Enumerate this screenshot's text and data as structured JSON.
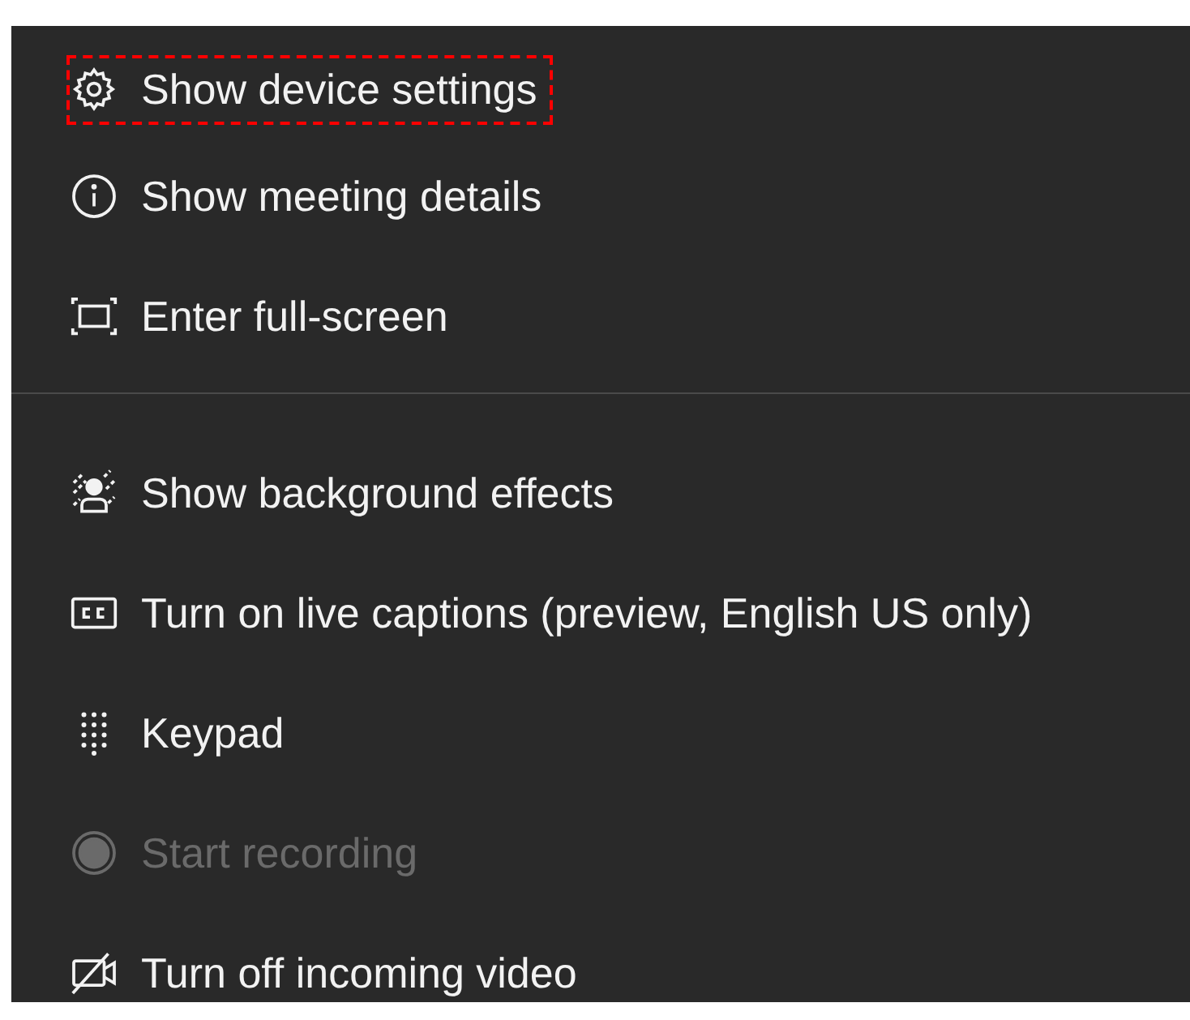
{
  "menu": {
    "sections": [
      {
        "items": [
          {
            "kind": "gear",
            "label": "Show device settings",
            "highlighted": true,
            "disabled": false
          },
          {
            "kind": "info",
            "label": "Show meeting details",
            "highlighted": false,
            "disabled": false
          },
          {
            "kind": "fullscreen",
            "label": "Enter full-screen",
            "highlighted": false,
            "disabled": false
          }
        ]
      },
      {
        "items": [
          {
            "kind": "background",
            "label": "Show background effects",
            "highlighted": false,
            "disabled": false
          },
          {
            "kind": "captions",
            "label": "Turn on live captions (preview, English US only)",
            "highlighted": false,
            "disabled": false
          },
          {
            "kind": "keypad",
            "label": "Keypad",
            "highlighted": false,
            "disabled": false
          },
          {
            "kind": "record",
            "label": "Start recording",
            "highlighted": false,
            "disabled": true
          },
          {
            "kind": "video-off",
            "label": "Turn off incoming video",
            "highlighted": false,
            "disabled": false
          }
        ]
      }
    ]
  }
}
